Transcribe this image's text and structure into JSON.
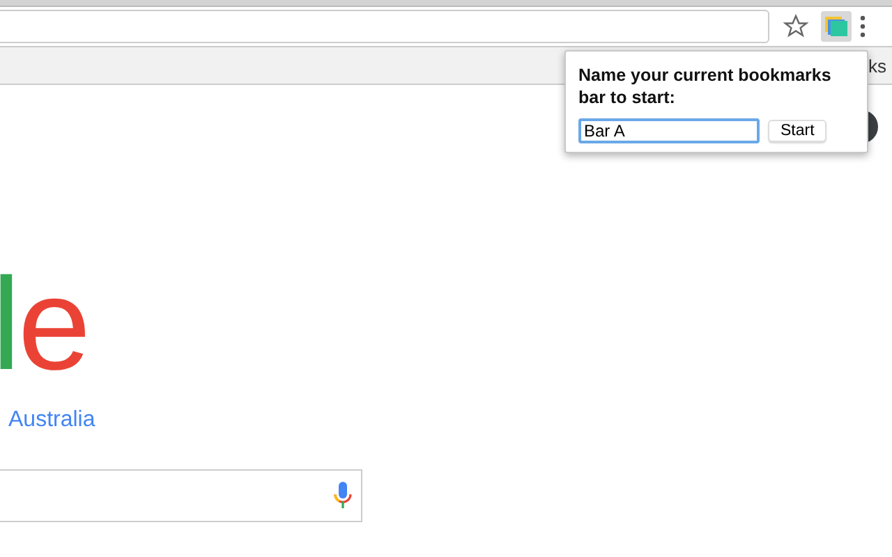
{
  "bookmarks_bar": {
    "visible_text": "ks"
  },
  "page": {
    "logo_text": "le",
    "region": "Australia"
  },
  "popup": {
    "prompt": "Name your current bookmarks bar to start:",
    "name_field": {
      "value": "Bar A"
    },
    "start_button": "Start"
  }
}
